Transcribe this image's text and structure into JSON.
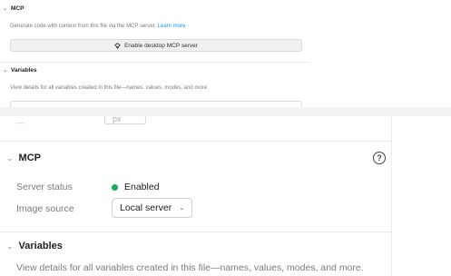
{
  "top": {
    "mcp": {
      "title": "MCP",
      "description": "Generate code with context from this file via the MCP server.",
      "link": "Learn more",
      "button_label": "Enable desktop MCP server",
      "button_icon": "mcp-icon"
    },
    "variables": {
      "title": "Variables",
      "description": "View details for all variables created in this file—names, values, modes, and more."
    }
  },
  "bottom": {
    "partial_field_value": "px",
    "mcp": {
      "title": "MCP",
      "help_icon": "help-icon",
      "server_status_label": "Server status",
      "server_status_value": "Enabled",
      "status_color": "#14ae5c",
      "image_source_label": "Image source",
      "image_source_value": "Local server"
    },
    "variables": {
      "title": "Variables",
      "description": "View details for all variables created in this file—names, values, modes, and more."
    }
  }
}
